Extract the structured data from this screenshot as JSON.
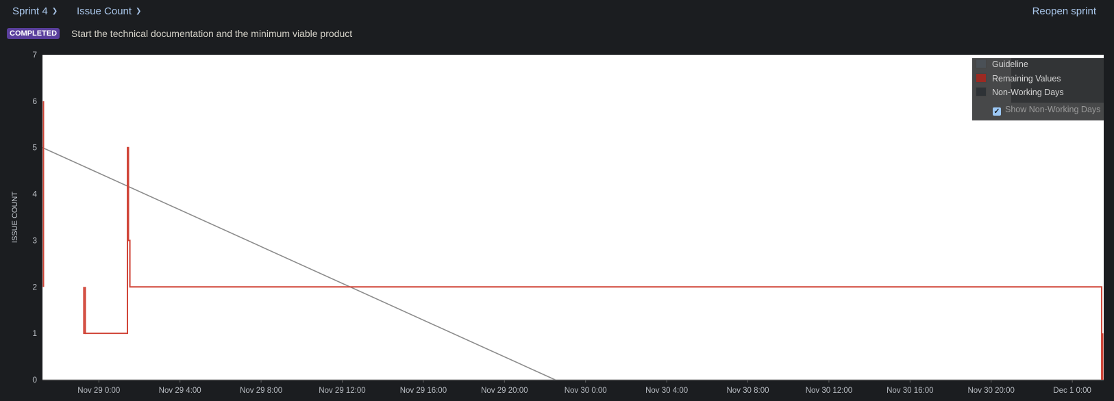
{
  "header": {
    "sprint_select": "Sprint 4",
    "metric_select": "Issue Count",
    "reopen_label": "Reopen sprint",
    "status_badge": "COMPLETED",
    "sprint_goal": "Start the technical documentation and the minimum viable product"
  },
  "chart_data": {
    "type": "line",
    "title": "",
    "xlabel": "",
    "ylabel": "ISSUE COUNT",
    "x_units": "hours since Nov 29 0:00",
    "xlim": [
      -2.78,
      49.55
    ],
    "ylim": [
      0,
      7
    ],
    "y_ticks": [
      0,
      1,
      2,
      3,
      4,
      5,
      6,
      7
    ],
    "x_ticks": [
      {
        "value": 0,
        "label": "Nov 29 0:00"
      },
      {
        "value": 4,
        "label": "Nov 29 4:00"
      },
      {
        "value": 8,
        "label": "Nov 29 8:00"
      },
      {
        "value": 12,
        "label": "Nov 29 12:00"
      },
      {
        "value": 16,
        "label": "Nov 29 16:00"
      },
      {
        "value": 20,
        "label": "Nov 29 20:00"
      },
      {
        "value": 24,
        "label": "Nov 30 0:00"
      },
      {
        "value": 28,
        "label": "Nov 30 4:00"
      },
      {
        "value": 32,
        "label": "Nov 30 8:00"
      },
      {
        "value": 36,
        "label": "Nov 30 12:00"
      },
      {
        "value": 40,
        "label": "Nov 30 16:00"
      },
      {
        "value": 44,
        "label": "Nov 30 20:00"
      },
      {
        "value": 48,
        "label": "Dec 1 0:00"
      }
    ],
    "grid": false,
    "legend_position": "top-right",
    "legend": [
      "Guideline",
      "Remaining Values",
      "Non-Working Days"
    ],
    "show_non_working_days_label": "Show Non-Working Days",
    "show_non_working_days": true,
    "series": [
      {
        "name": "Guideline",
        "color": "#8c8c8c",
        "segments": [
          [
            [
              -2.78,
              5
            ],
            [
              22.5,
              0
            ]
          ]
        ]
      },
      {
        "name": "Remaining Values",
        "color": "#d04437",
        "segments": [
          [
            [
              -2.73,
              6
            ],
            [
              -2.73,
              2
            ]
          ],
          [
            [
              -0.74,
              2
            ],
            [
              -0.74,
              1
            ],
            [
              -0.67,
              1
            ],
            [
              -0.67,
              2
            ]
          ],
          [
            [
              -0.67,
              1
            ],
            [
              1.41,
              1
            ],
            [
              1.41,
              5
            ],
            [
              1.46,
              5
            ],
            [
              1.46,
              3
            ],
            [
              1.53,
              3
            ],
            [
              1.53,
              2
            ],
            [
              49.45,
              2
            ],
            [
              49.45,
              0
            ]
          ],
          [
            [
              49.5,
              1
            ],
            [
              49.5,
              0
            ]
          ]
        ]
      }
    ]
  },
  "colors": {
    "guideline": "#4a5056",
    "remaining": "#9b2a22",
    "non_working": "#2e3236"
  }
}
